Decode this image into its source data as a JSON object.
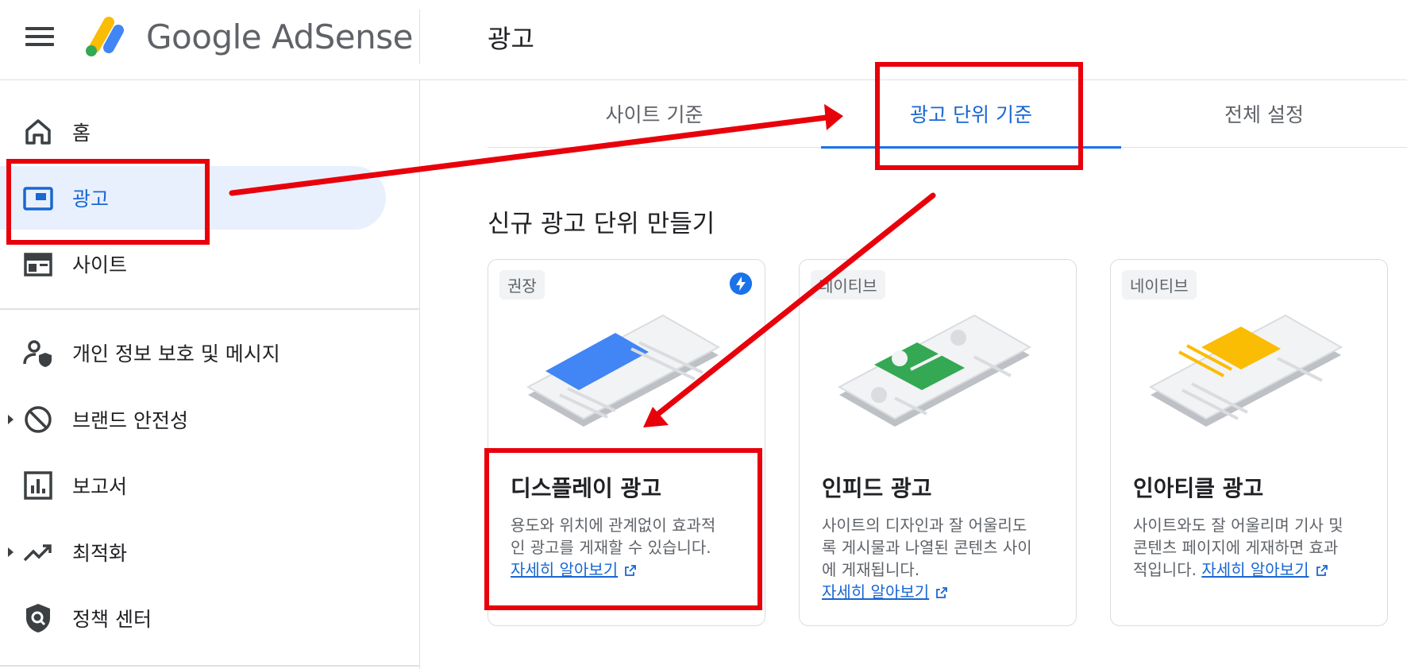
{
  "app": {
    "brand": "Google AdSense",
    "page_title": "광고"
  },
  "sidebar": {
    "items": [
      {
        "label": "홈",
        "icon": "home-icon"
      },
      {
        "label": "광고",
        "icon": "ads-icon",
        "active": true
      },
      {
        "label": "사이트",
        "icon": "sites-icon"
      },
      {
        "label": "개인 정보 보호 및 메시지",
        "icon": "privacy-icon"
      },
      {
        "label": "브랜드 안전성",
        "icon": "brand-safety-icon",
        "expandable": true
      },
      {
        "label": "보고서",
        "icon": "reports-icon"
      },
      {
        "label": "최적화",
        "icon": "optimization-icon",
        "expandable": true
      },
      {
        "label": "정책 센터",
        "icon": "policy-center-icon"
      }
    ]
  },
  "tabs": [
    {
      "label": "사이트 기준"
    },
    {
      "label": "광고 단위 기준",
      "active": true
    },
    {
      "label": "전체 설정"
    }
  ],
  "main": {
    "section_title": "신규 광고 단위 만들기",
    "cards": [
      {
        "chip": "권장",
        "title": "디스플레이 광고",
        "desc_lines": [
          "용도와 위치에 관계없이 효과적",
          "인 광고를 게재할 수 있습니다."
        ],
        "link": "자세히 알아보기",
        "accent": "#4285f4",
        "badge_icon": "bolt-icon"
      },
      {
        "chip": "네이티브",
        "title": "인피드 광고",
        "desc_lines": [
          "사이트의 디자인과 잘 어울리도",
          "록 게시물과 나열된 콘텐츠 사이",
          "에 게재됩니다."
        ],
        "link": "자세히 알아보기",
        "accent": "#34a853"
      },
      {
        "chip": "네이티브",
        "title": "인아티클 광고",
        "desc_lines": [
          "사이트와도 잘 어울리며 기사 및",
          "콘텐츠 페이지에 게재하면 효과"
        ],
        "desc_tail": "적입니다. ",
        "link": "자세히 알아보기",
        "accent": "#fbbc04"
      }
    ]
  },
  "colors": {
    "brand_blue": "#1a73e8",
    "active_bg": "#e8f0fe",
    "annotation_red": "#e8000b"
  }
}
